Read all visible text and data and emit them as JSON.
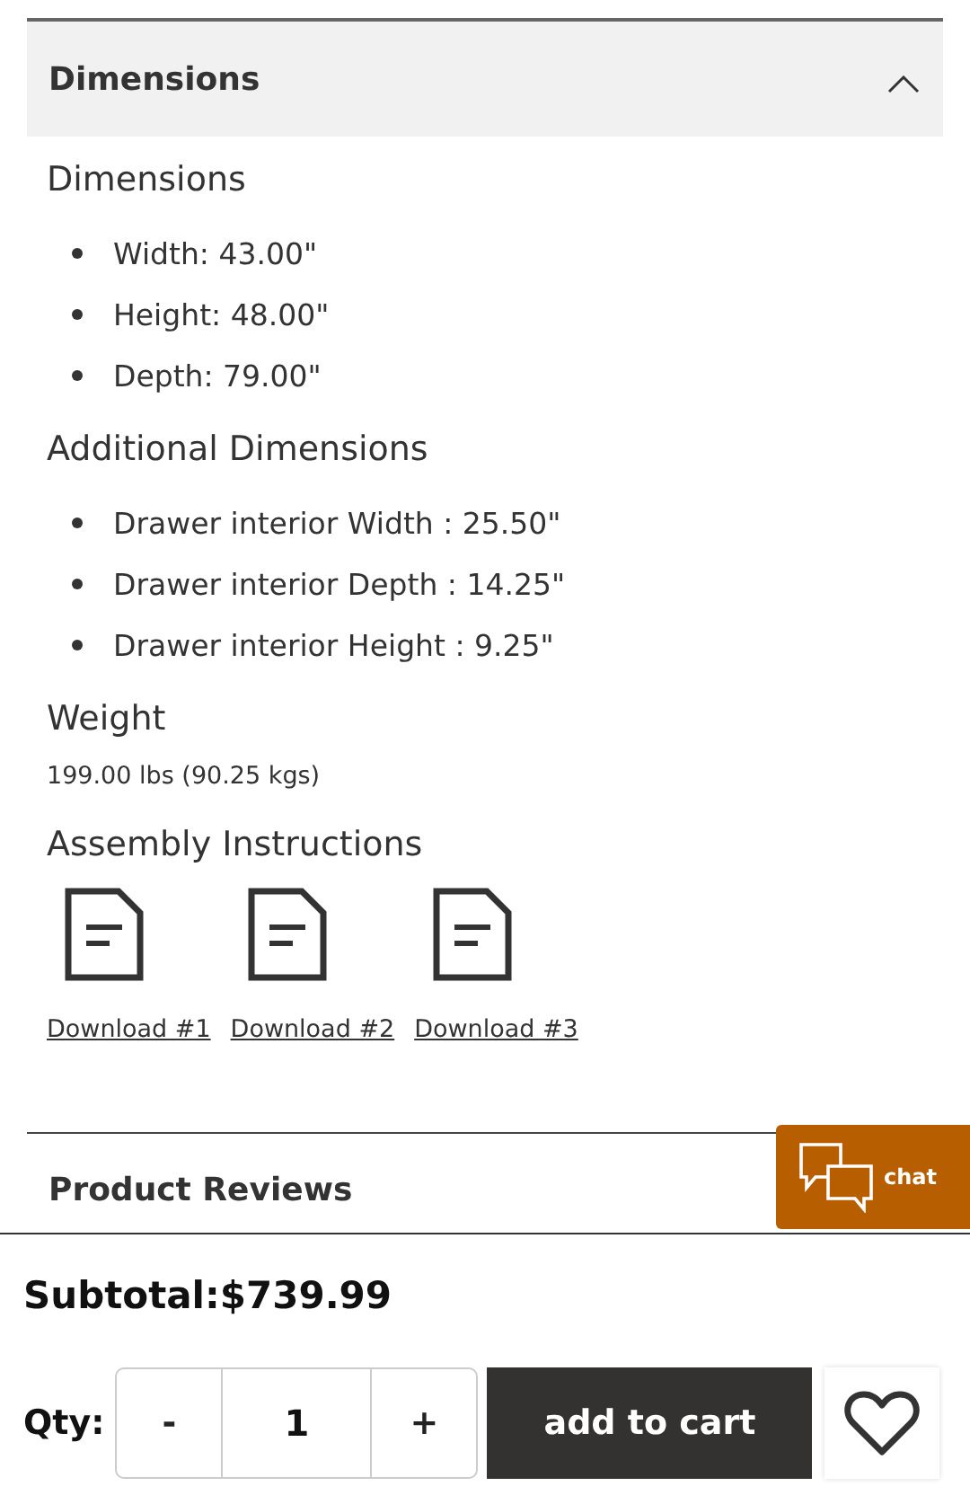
{
  "accordion": {
    "title": "Dimensions",
    "expanded": true
  },
  "sections": [
    {
      "heading": "Dimensions",
      "items": [
        "Width: 43.00\"",
        "Height: 48.00\"",
        "Depth: 79.00\""
      ]
    },
    {
      "heading": "Additional Dimensions",
      "items": [
        "Drawer interior Width : 25.50\"",
        "Drawer interior Depth : 14.25\"",
        "Drawer interior Height : 9.25\""
      ]
    }
  ],
  "weight": {
    "heading": "Weight",
    "value": "199.00 lbs (90.25 kgs)"
  },
  "assembly": {
    "heading": "Assembly Instructions",
    "downloads": [
      "Download #1",
      "Download #2",
      "Download #3"
    ]
  },
  "reviews": {
    "title": "Product Reviews"
  },
  "chat": {
    "label": "chat"
  },
  "cart": {
    "subtotal": "Subtotal:$739.99",
    "qty_label": "Qty:",
    "decrement": "-",
    "quantity": "1",
    "increment": "+",
    "add_button": "add to cart"
  }
}
